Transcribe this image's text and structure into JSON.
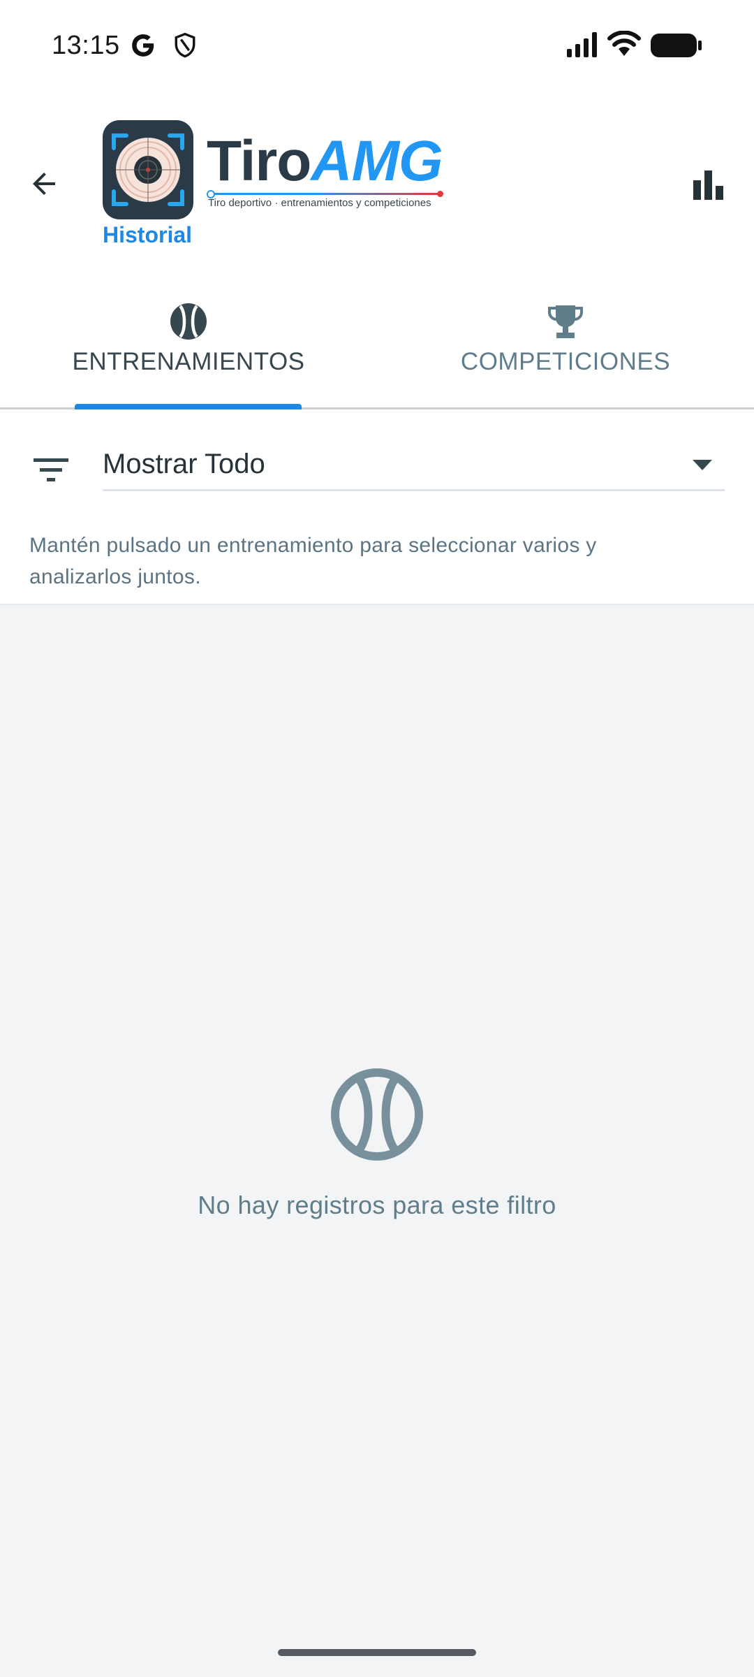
{
  "status_bar": {
    "time": "13:15",
    "icons": [
      "google-g-icon",
      "shield-icon",
      "signal-icon",
      "wifi-icon",
      "battery-icon"
    ]
  },
  "app_bar": {
    "back_icon": "arrow-left-icon",
    "logo": {
      "title_part1": "Tiro",
      "title_part2": "AMG",
      "tagline": "Tiro deportivo · entrenamientos y competiciones"
    },
    "screen_title": "Historial",
    "action_icon": "bar-chart-icon"
  },
  "tabs": [
    {
      "label": "ENTRENAMIENTOS",
      "icon": "ball-icon",
      "active": true
    },
    {
      "label": "COMPETICIONES",
      "icon": "trophy-icon",
      "active": false
    }
  ],
  "filter": {
    "icon": "filter-list-icon",
    "selected_value": "Mostrar Todo",
    "hint": "Mantén pulsado un entrenamiento para seleccionar varios y analizarlos juntos."
  },
  "empty_state": {
    "icon": "ball-icon",
    "message": "No hay registros para este filtro"
  },
  "colors": {
    "accent": "#1e88e5",
    "text_primary": "#263238",
    "text_secondary": "#607d8b",
    "background": "#f2f4f6"
  }
}
